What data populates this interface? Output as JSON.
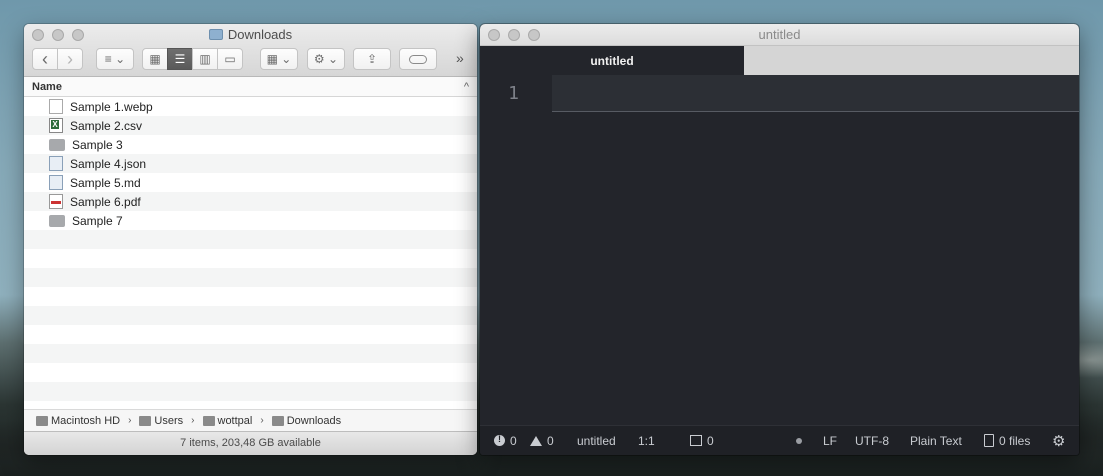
{
  "finder": {
    "title": "Downloads",
    "toolbar": {
      "back": "‹",
      "forward": "›",
      "more": "»"
    },
    "column_header": "Name",
    "sort_indicator": "^",
    "files": [
      {
        "name": "Sample 1.webp",
        "icon": "doc"
      },
      {
        "name": "Sample 2.csv",
        "icon": "csv"
      },
      {
        "name": "Sample 3",
        "icon": "folder"
      },
      {
        "name": "Sample 4.json",
        "icon": "json"
      },
      {
        "name": "Sample 5.md",
        "icon": "md"
      },
      {
        "name": "Sample 6.pdf",
        "icon": "pdf"
      },
      {
        "name": "Sample 7",
        "icon": "folder"
      }
    ],
    "path": [
      "Macintosh HD",
      "Users",
      "wottpal",
      "Downloads"
    ],
    "status": "7 items, 203,48 GB available"
  },
  "editor": {
    "title": "untitled",
    "tab": "untitled",
    "line_number": "1",
    "status": {
      "errors": "0",
      "warnings": "0",
      "filename": "untitled",
      "cursor": "1:1",
      "lint": "0",
      "line_ending": "LF",
      "encoding": "UTF-8",
      "grammar": "Plain Text",
      "files": "0 files"
    }
  },
  "colors": {
    "editor_bg": "#23252b",
    "finder_bg": "#ffffff"
  }
}
